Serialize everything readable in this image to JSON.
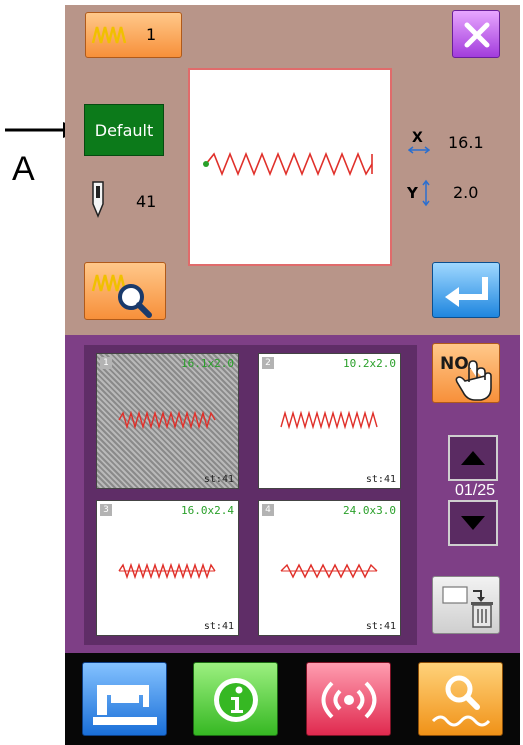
{
  "annotation": {
    "letter": "A"
  },
  "top": {
    "stitch_count": "1",
    "default_label": "Default",
    "needle_value": "41",
    "x_value": "16.1",
    "y_value": "2.0"
  },
  "patterns": [
    {
      "index": "1",
      "dimensions": "16.1x2.0",
      "stitches": "st:41",
      "selected": true
    },
    {
      "index": "2",
      "dimensions": "10.2x2.0",
      "stitches": "st:41",
      "selected": false
    },
    {
      "index": "3",
      "dimensions": "16.0x2.4",
      "stitches": "st:41",
      "selected": false
    },
    {
      "index": "4",
      "dimensions": "24.0x3.0",
      "stitches": "st:41",
      "selected": false
    }
  ],
  "pager": {
    "no_label": "NO.",
    "indicator": "01/25"
  },
  "icons": {
    "stitch": "zigzag-stitch-icon",
    "close": "close-icon",
    "needle": "needle-icon",
    "x_dim": "x-width-icon",
    "y_dim": "y-height-icon",
    "zoom": "zoom-pattern-icon",
    "enter": "enter-icon",
    "no_select": "hand-pointer-icon",
    "up": "arrow-up-icon",
    "down": "arrow-down-icon",
    "delete": "delete-pattern-icon",
    "sew": "sewing-machine-icon",
    "info": "info-icon",
    "comm": "communication-icon",
    "search": "search-icon"
  },
  "colors": {
    "top_panel": "#b89589",
    "mid_panel": "#7e3f86",
    "default_button": "#0c7a1a",
    "stitch_red": "#e0302a"
  }
}
